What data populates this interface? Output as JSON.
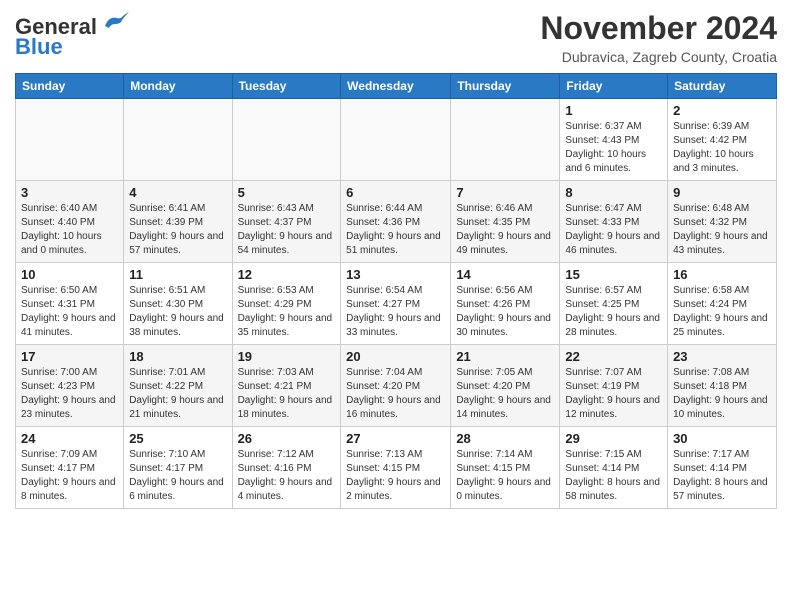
{
  "header": {
    "logo_general": "General",
    "logo_blue": "Blue",
    "month_title": "November 2024",
    "location": "Dubravica, Zagreb County, Croatia"
  },
  "weekdays": [
    "Sunday",
    "Monday",
    "Tuesday",
    "Wednesday",
    "Thursday",
    "Friday",
    "Saturday"
  ],
  "weeks": [
    [
      {
        "day": "",
        "info": ""
      },
      {
        "day": "",
        "info": ""
      },
      {
        "day": "",
        "info": ""
      },
      {
        "day": "",
        "info": ""
      },
      {
        "day": "",
        "info": ""
      },
      {
        "day": "1",
        "info": "Sunrise: 6:37 AM\nSunset: 4:43 PM\nDaylight: 10 hours and 6 minutes."
      },
      {
        "day": "2",
        "info": "Sunrise: 6:39 AM\nSunset: 4:42 PM\nDaylight: 10 hours and 3 minutes."
      }
    ],
    [
      {
        "day": "3",
        "info": "Sunrise: 6:40 AM\nSunset: 4:40 PM\nDaylight: 10 hours and 0 minutes."
      },
      {
        "day": "4",
        "info": "Sunrise: 6:41 AM\nSunset: 4:39 PM\nDaylight: 9 hours and 57 minutes."
      },
      {
        "day": "5",
        "info": "Sunrise: 6:43 AM\nSunset: 4:37 PM\nDaylight: 9 hours and 54 minutes."
      },
      {
        "day": "6",
        "info": "Sunrise: 6:44 AM\nSunset: 4:36 PM\nDaylight: 9 hours and 51 minutes."
      },
      {
        "day": "7",
        "info": "Sunrise: 6:46 AM\nSunset: 4:35 PM\nDaylight: 9 hours and 49 minutes."
      },
      {
        "day": "8",
        "info": "Sunrise: 6:47 AM\nSunset: 4:33 PM\nDaylight: 9 hours and 46 minutes."
      },
      {
        "day": "9",
        "info": "Sunrise: 6:48 AM\nSunset: 4:32 PM\nDaylight: 9 hours and 43 minutes."
      }
    ],
    [
      {
        "day": "10",
        "info": "Sunrise: 6:50 AM\nSunset: 4:31 PM\nDaylight: 9 hours and 41 minutes."
      },
      {
        "day": "11",
        "info": "Sunrise: 6:51 AM\nSunset: 4:30 PM\nDaylight: 9 hours and 38 minutes."
      },
      {
        "day": "12",
        "info": "Sunrise: 6:53 AM\nSunset: 4:29 PM\nDaylight: 9 hours and 35 minutes."
      },
      {
        "day": "13",
        "info": "Sunrise: 6:54 AM\nSunset: 4:27 PM\nDaylight: 9 hours and 33 minutes."
      },
      {
        "day": "14",
        "info": "Sunrise: 6:56 AM\nSunset: 4:26 PM\nDaylight: 9 hours and 30 minutes."
      },
      {
        "day": "15",
        "info": "Sunrise: 6:57 AM\nSunset: 4:25 PM\nDaylight: 9 hours and 28 minutes."
      },
      {
        "day": "16",
        "info": "Sunrise: 6:58 AM\nSunset: 4:24 PM\nDaylight: 9 hours and 25 minutes."
      }
    ],
    [
      {
        "day": "17",
        "info": "Sunrise: 7:00 AM\nSunset: 4:23 PM\nDaylight: 9 hours and 23 minutes."
      },
      {
        "day": "18",
        "info": "Sunrise: 7:01 AM\nSunset: 4:22 PM\nDaylight: 9 hours and 21 minutes."
      },
      {
        "day": "19",
        "info": "Sunrise: 7:03 AM\nSunset: 4:21 PM\nDaylight: 9 hours and 18 minutes."
      },
      {
        "day": "20",
        "info": "Sunrise: 7:04 AM\nSunset: 4:20 PM\nDaylight: 9 hours and 16 minutes."
      },
      {
        "day": "21",
        "info": "Sunrise: 7:05 AM\nSunset: 4:20 PM\nDaylight: 9 hours and 14 minutes."
      },
      {
        "day": "22",
        "info": "Sunrise: 7:07 AM\nSunset: 4:19 PM\nDaylight: 9 hours and 12 minutes."
      },
      {
        "day": "23",
        "info": "Sunrise: 7:08 AM\nSunset: 4:18 PM\nDaylight: 9 hours and 10 minutes."
      }
    ],
    [
      {
        "day": "24",
        "info": "Sunrise: 7:09 AM\nSunset: 4:17 PM\nDaylight: 9 hours and 8 minutes."
      },
      {
        "day": "25",
        "info": "Sunrise: 7:10 AM\nSunset: 4:17 PM\nDaylight: 9 hours and 6 minutes."
      },
      {
        "day": "26",
        "info": "Sunrise: 7:12 AM\nSunset: 4:16 PM\nDaylight: 9 hours and 4 minutes."
      },
      {
        "day": "27",
        "info": "Sunrise: 7:13 AM\nSunset: 4:15 PM\nDaylight: 9 hours and 2 minutes."
      },
      {
        "day": "28",
        "info": "Sunrise: 7:14 AM\nSunset: 4:15 PM\nDaylight: 9 hours and 0 minutes."
      },
      {
        "day": "29",
        "info": "Sunrise: 7:15 AM\nSunset: 4:14 PM\nDaylight: 8 hours and 58 minutes."
      },
      {
        "day": "30",
        "info": "Sunrise: 7:17 AM\nSunset: 4:14 PM\nDaylight: 8 hours and 57 minutes."
      }
    ]
  ]
}
